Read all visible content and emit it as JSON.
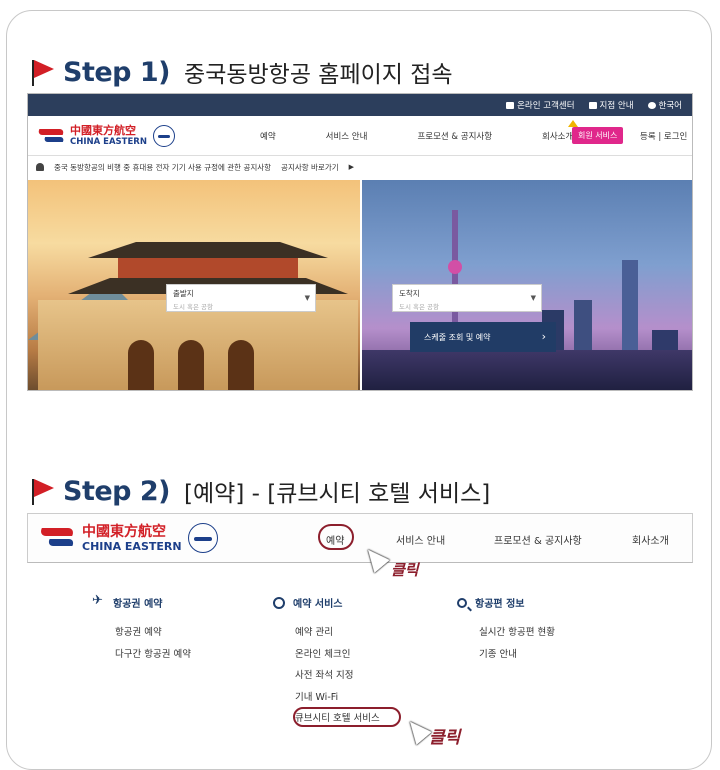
{
  "step1": {
    "num": "Step 1)",
    "text": "중국동방항공 홈페이지 접속",
    "topbar": [
      "온라인 고객센터",
      "지점 안내",
      "한국어"
    ],
    "logo": {
      "cn": "中國東方航空",
      "en": "CHINA EASTERN"
    },
    "menu": [
      "예약",
      "서비스 안내",
      "프로모션 & 공지사항",
      "회사소개"
    ],
    "member_btn": "회원 서비스",
    "login": "등록 | 로그인",
    "notice": "중국 동방항공의 비행 중 휴대용 전자 기기 사용 규정에 관한 공지사항",
    "notice_link": "공지사항 바로가기",
    "origin": {
      "label": "출발지",
      "placeholder": "도시 혹은 공항"
    },
    "destination": {
      "label": "도착지",
      "placeholder": "도시 혹은 공항"
    },
    "search_btn": "스케줄 조회 및 예약"
  },
  "step2": {
    "num": "Step 2)",
    "text": "[예약] - [큐브시티 호텔 서비스]",
    "logo": {
      "cn": "中國東方航空",
      "en": "CHINA EASTERN"
    },
    "menu": [
      "예약",
      "서비스 안내",
      "프로모션 & 공지사항",
      "회사소개"
    ],
    "click1": "클릭",
    "click2": "클릭",
    "cols": [
      {
        "icon": "plane-icon",
        "head": "항공권 예약",
        "items": [
          "항공권 예약",
          "다구간 항공권 예약"
        ]
      },
      {
        "icon": "service-icon",
        "head": "예약 서비스",
        "items": [
          "예약 관리",
          "온라인 체크인",
          "사전 좌석 지정",
          "기내 Wi-Fi",
          "큐브시티 호텔 서비스"
        ]
      },
      {
        "icon": "search-icon",
        "head": "항공편 정보",
        "items": [
          "실시간 항공편 현황",
          "기종 안내"
        ]
      }
    ]
  },
  "colors": {
    "brand_red": "#d21f26",
    "brand_blue": "#1c3f8a",
    "nav_dark": "#2c3e5c",
    "member_pink": "#e0278b",
    "annotation": "#8c1e2c"
  }
}
